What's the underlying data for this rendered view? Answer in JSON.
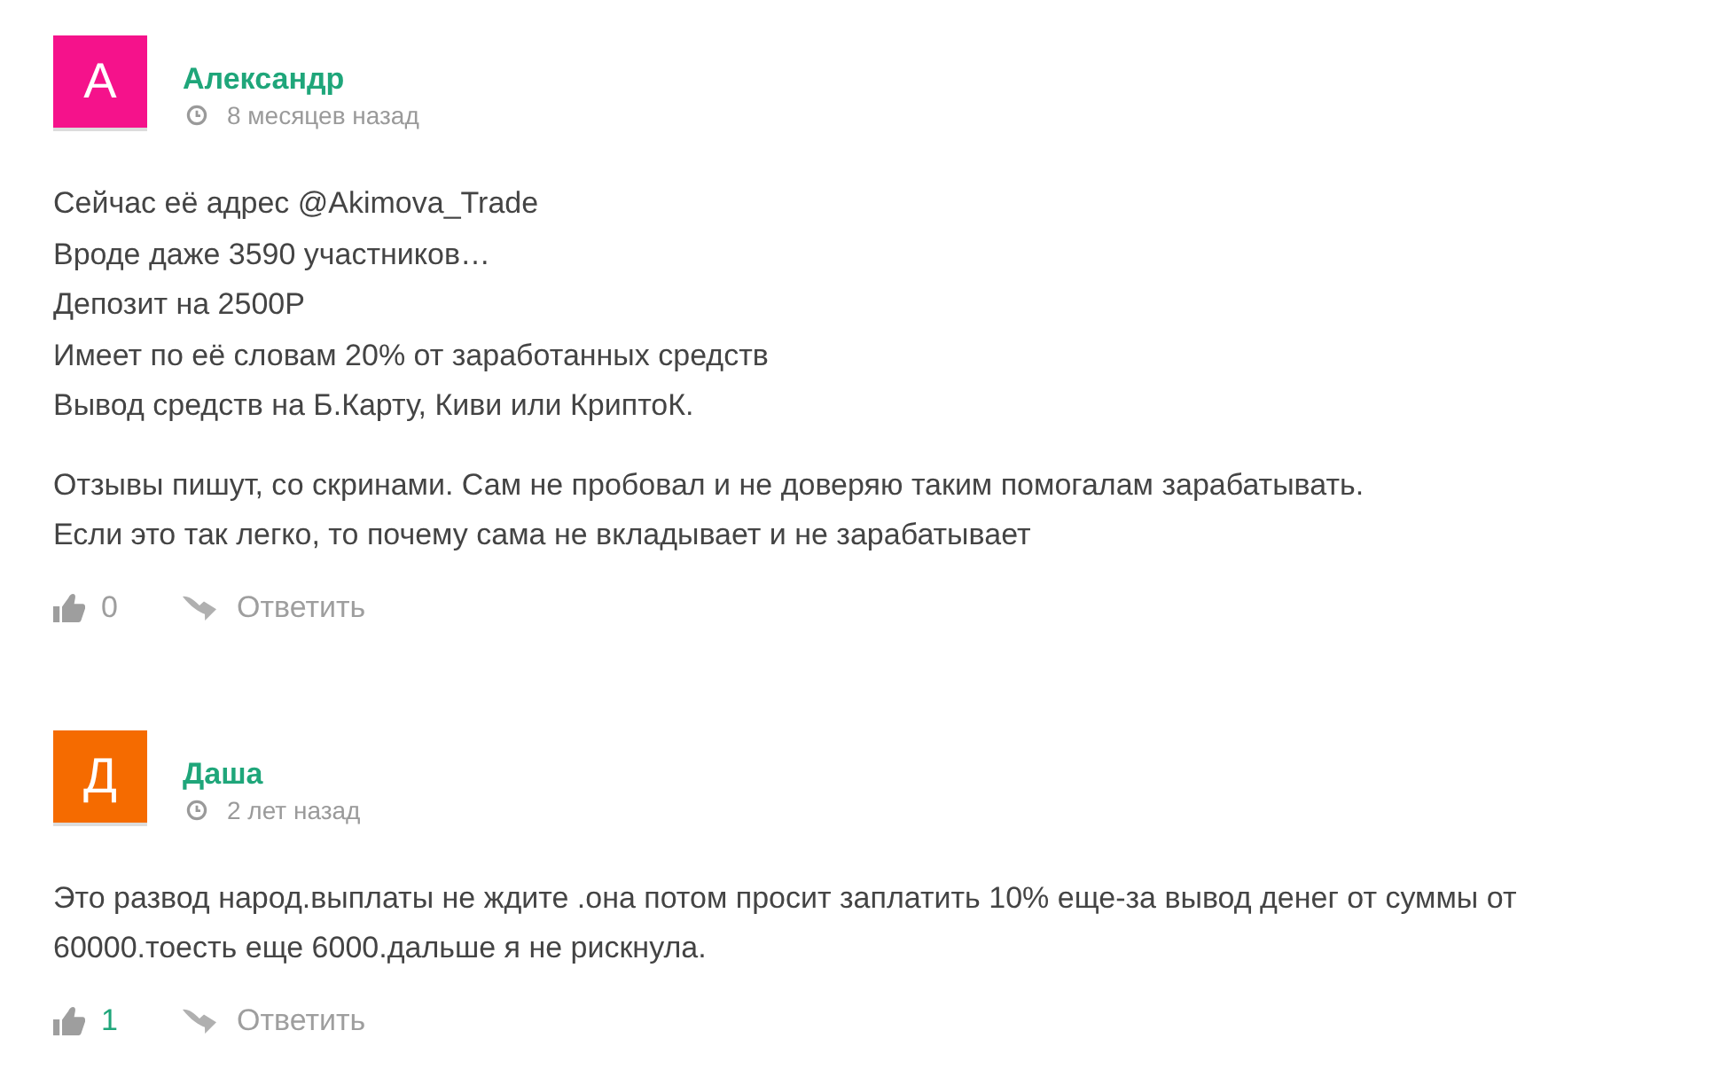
{
  "comments": [
    {
      "avatar": {
        "letter": "А",
        "color": "#f5128b"
      },
      "author": "Александр",
      "time": "8 месяцев назад",
      "paragraphs": [
        [
          "Сейчас её адрес @Akimova_Trade",
          "Вроде даже 3590 участников…",
          "Депозит на 2500Р",
          "Имеет по её словам 20% от заработанных средств",
          "Вывод средств на Б.Карту, Киви или КриптоК."
        ],
        [
          "Отзывы пишут, со скринами. Сам не пробовал и не доверяю таким помогалам зарабатывать.",
          "Если это так легко, то почему сама не вкладывает и не зарабатывает"
        ]
      ],
      "likes": {
        "count": "0",
        "positive": false
      },
      "reply": "Ответить"
    },
    {
      "avatar": {
        "letter": "Д",
        "color": "#f56b00"
      },
      "author": "Даша",
      "time": "2 лет назад",
      "paragraphs": [
        [
          "Это развод народ.выплаты не ждите .она потом просит заплатить 10% еще-за вывод денег от суммы от 60000.тоесть еще 6000.дальше я не рискнула."
        ]
      ],
      "likes": {
        "count": "1",
        "positive": true
      },
      "reply": "Ответить"
    }
  ]
}
